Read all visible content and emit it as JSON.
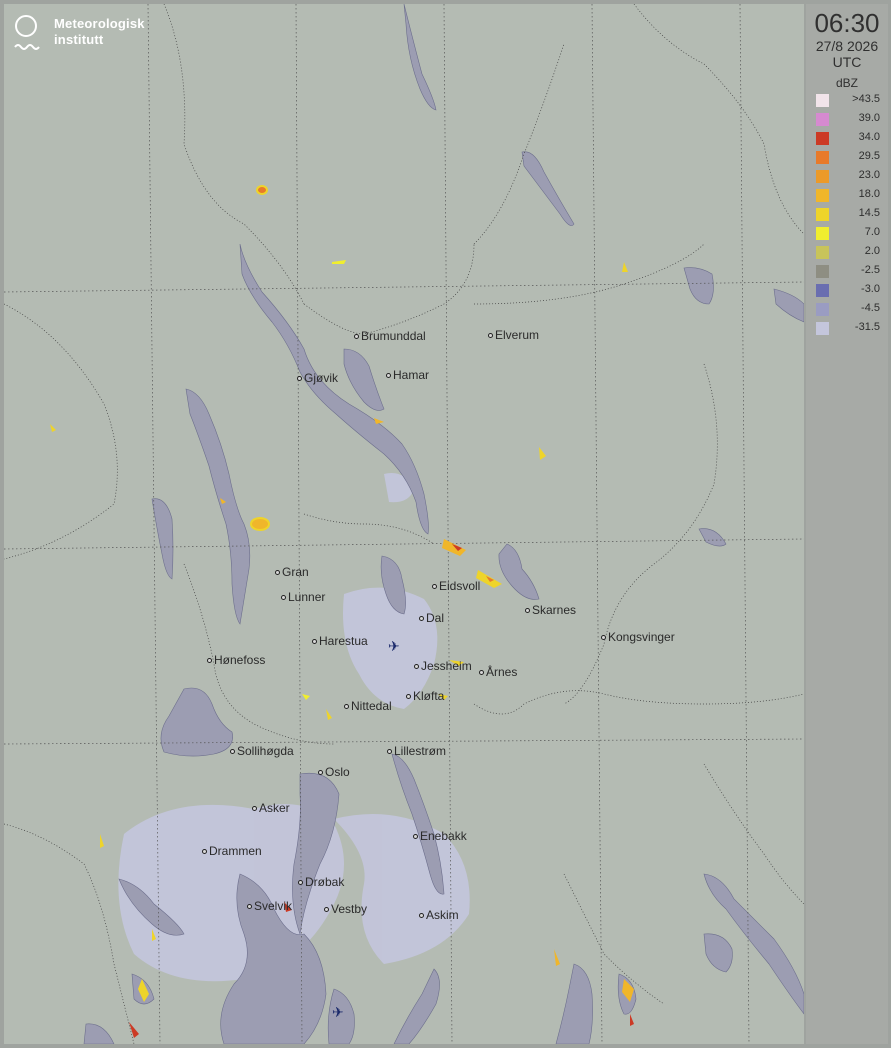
{
  "branding": {
    "line1": "Meteorologisk",
    "line2": "institutt",
    "logo_icon": "met-logo-icon"
  },
  "timestamp": {
    "time": "06:30",
    "date": "27/8 2026",
    "zone": "UTC"
  },
  "legend": {
    "unit": "dBZ",
    "entries": [
      {
        "label": ">43.5",
        "color": "#f2e4ea"
      },
      {
        "label": "39.0",
        "color": "#d68ad0"
      },
      {
        "label": "34.0",
        "color": "#cc3a25"
      },
      {
        "label": "29.5",
        "color": "#e87a2a"
      },
      {
        "label": "23.0",
        "color": "#ec9a28"
      },
      {
        "label": "18.0",
        "color": "#f0b62a"
      },
      {
        "label": "14.5",
        "color": "#eed42a"
      },
      {
        "label": "7.0",
        "color": "#f0ee2e"
      },
      {
        "label": "2.0",
        "color": "#c8c45a"
      },
      {
        "label": "-2.5",
        "color": "#8e8e82"
      },
      {
        "label": "-3.0",
        "color": "#6a6eb0"
      },
      {
        "label": "-4.5",
        "color": "#9a9cc2"
      },
      {
        "label": "-31.5",
        "color": "#c4c6dc"
      }
    ]
  },
  "cities": [
    {
      "name": "Brumunddal"
    },
    {
      "name": "Elverum"
    },
    {
      "name": "Gjøvik"
    },
    {
      "name": "Hamar"
    },
    {
      "name": "Gran"
    },
    {
      "name": "Lunner"
    },
    {
      "name": "Eidsvoll"
    },
    {
      "name": "Dal"
    },
    {
      "name": "Skarnes"
    },
    {
      "name": "Kongsvinger"
    },
    {
      "name": "Harestua"
    },
    {
      "name": "Hønefoss"
    },
    {
      "name": "Jessheim"
    },
    {
      "name": "Årnes"
    },
    {
      "name": "Kløfta"
    },
    {
      "name": "Nittedal"
    },
    {
      "name": "Sollihøgda"
    },
    {
      "name": "Lillestrøm"
    },
    {
      "name": "Oslo"
    },
    {
      "name": "Asker"
    },
    {
      "name": "Enebakk"
    },
    {
      "name": "Drammen"
    },
    {
      "name": "Drøbak"
    },
    {
      "name": "Svelvik"
    },
    {
      "name": "Vestby"
    },
    {
      "name": "Askim"
    }
  ],
  "icons": {
    "airport": "airplane-icon"
  }
}
